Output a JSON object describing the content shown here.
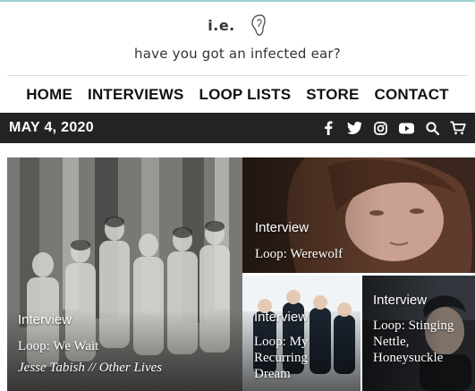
{
  "brand": {
    "name": "i.e.",
    "tagline": "have you got an infected ear?",
    "logo_icon": "ear-icon"
  },
  "nav": {
    "items": [
      "HOME",
      "INTERVIEWS",
      "LOOP LISTS",
      "STORE",
      "CONTACT"
    ]
  },
  "topbar": {
    "date": "MAY 4, 2020",
    "icons": [
      "facebook-icon",
      "twitter-icon",
      "instagram-icon",
      "youtube-icon",
      "search-icon",
      "cart-icon"
    ]
  },
  "tiles": [
    {
      "label": "Interview",
      "title": "Loop: We Wait",
      "byline": "Jesse Tabish // Other Lives"
    },
    {
      "label": "Interview",
      "title": "Loop: Werewolf"
    },
    {
      "label": "Interview",
      "title": "Loop: My Recurring Dream"
    },
    {
      "label": "Interview",
      "title": "Loop: Stinging Nettle, Honeysuckle"
    }
  ],
  "colors": {
    "accent_line": "#9ed3d0",
    "bar": "#222325"
  }
}
